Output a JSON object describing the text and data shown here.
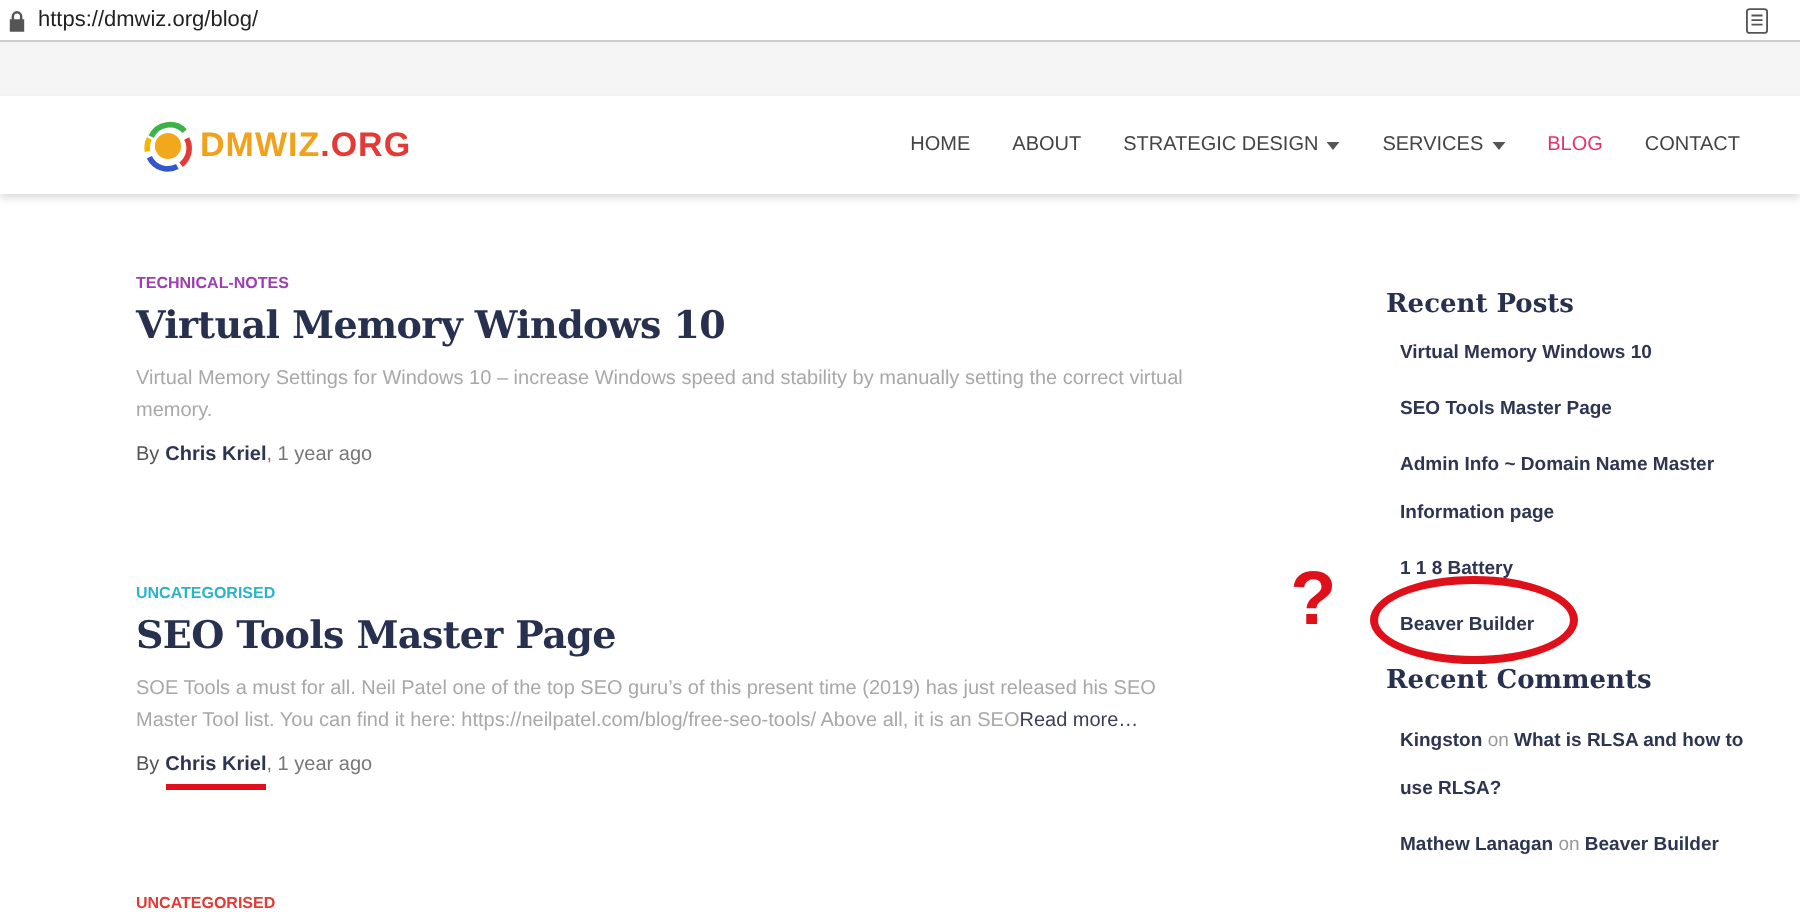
{
  "browser": {
    "url": "https://dmwiz.org/blog/"
  },
  "logo": {
    "name": "DMWIZ",
    "suffix": ".ORG"
  },
  "nav": [
    {
      "label": "HOME",
      "dropdown": false,
      "selected": false
    },
    {
      "label": "ABOUT",
      "dropdown": false,
      "selected": false
    },
    {
      "label": "STRATEGIC DESIGN",
      "dropdown": true,
      "selected": false
    },
    {
      "label": "SERVICES",
      "dropdown": true,
      "selected": false
    },
    {
      "label": "BLOG",
      "dropdown": false,
      "selected": true
    },
    {
      "label": "CONTACT",
      "dropdown": false,
      "selected": false
    }
  ],
  "posts": [
    {
      "category": "TECHNICAL-NOTES",
      "color": "#9c3fb0",
      "title": "Virtual Memory Windows 10",
      "excerpt": "Virtual Memory Settings for Windows 10 – increase Windows speed and stability by manually setting the correct virtual memory.",
      "by": "By",
      "author": "Chris Kriel",
      "age": ", 1 year ago",
      "underlined": false
    },
    {
      "category": "UNCATEGORISED",
      "color": "#2bb3c9",
      "title": "SEO Tools Master Page",
      "excerpt": "SOE Tools a must for all.   Neil Patel one of the top SEO guru’s of this present time (2019) has just released his SEO Master Tool list. You can find it here: https://neilpatel.com/blog/free-seo-tools/ Above all, it is an SEO",
      "read_more": "Read more…",
      "by": "By",
      "author": "Chris Kriel",
      "age": ", 1 year ago",
      "underlined": true
    },
    {
      "category": "UNCATEGORISED",
      "color": "#e53935"
    }
  ],
  "sidebar": {
    "recent_posts": {
      "heading": "Recent Posts",
      "items": [
        {
          "label": "Virtual Memory Windows 10",
          "circled": false
        },
        {
          "label": "SEO Tools Master Page",
          "circled": false
        },
        {
          "label": "Admin Info ~ Domain Name Master Information page",
          "circled": false
        },
        {
          "label": "1 1 8 Battery",
          "circled": false
        },
        {
          "label": "Beaver Builder",
          "circled": true
        }
      ]
    },
    "recent_comments": {
      "heading": "Recent Comments",
      "items": [
        {
          "author": "Kingston",
          "on": "on",
          "post": "What is RLSA and how to use RLSA?"
        },
        {
          "author": "Mathew Lanagan",
          "on": "on",
          "post": "Beaver Builder"
        }
      ]
    }
  },
  "annotation": {
    "mark": "?"
  }
}
